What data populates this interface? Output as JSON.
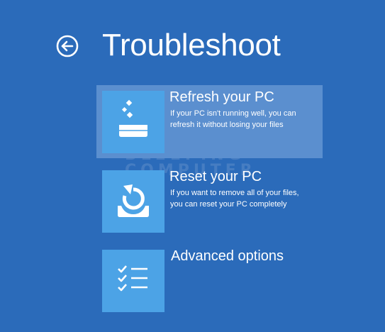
{
  "header": {
    "title": "Troubleshoot",
    "back_icon": "back-arrow-icon"
  },
  "options": [
    {
      "title": "Refresh your PC",
      "description_lines": [
        "If your PC isn't running well, you can",
        "refresh it without losing your files"
      ],
      "icon": "refresh-pc-icon",
      "selected": true
    },
    {
      "title": "Reset your PC",
      "description_lines": [
        "If you want to remove all of your files,",
        "you can reset your PC completely"
      ],
      "icon": "reset-pc-icon",
      "selected": false
    },
    {
      "title": "Advanced options",
      "description_lines": [],
      "icon": "advanced-options-icon",
      "selected": false
    }
  ],
  "watermark": {
    "line1": "BLEEPING",
    "line2": "COMPUTER"
  },
  "colors": {
    "background": "#2b6bba",
    "tile": "#4ca3e6",
    "selected_highlight": "#5b8fcf",
    "text": "#ffffff"
  }
}
